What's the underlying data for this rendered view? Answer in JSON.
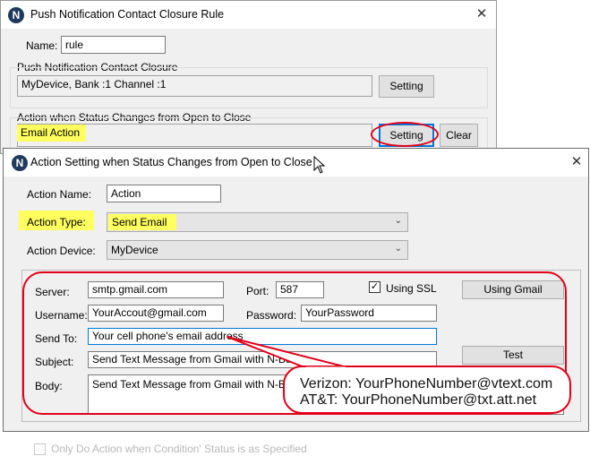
{
  "back_window": {
    "title": "Push Notification Contact Closure Rule",
    "name_label": "Name:",
    "name_value": "rule",
    "group1_title": "Push Notification Contact Closure",
    "device_text": "MyDevice, Bank :1 Channel :1",
    "setting1_label": "Setting",
    "group2_title": "Action when Status Changes from Open to Close",
    "action_text": "Email Action",
    "setting2_label": "Setting",
    "clear_label": "Clear",
    "footer_checkbox_label": "Only Do Action when Condition' Status is as Specified"
  },
  "front_window": {
    "title": "Action Setting when Status Changes from Open to Close",
    "action_name_label": "Action Name:",
    "action_name_value": "Action",
    "action_type_label": "Action Type:",
    "action_type_value": "Send Email",
    "action_device_label": "Action Device:",
    "action_device_value": "MyDevice",
    "server_label": "Server:",
    "server_value": "smtp.gmail.com",
    "port_label": "Port:",
    "port_value": "587",
    "ssl_label": "Using SSL",
    "ssl_checked": true,
    "using_gmail_label": "Using Gmail",
    "username_label": "Username:",
    "username_value": "YourAccout@gmail.com",
    "password_label": "Password:",
    "password_value": "YourPassword",
    "sendto_label": "Send To:",
    "sendto_value": "Your cell phone's email address",
    "test_label": "Test",
    "subject_label": "Subject:",
    "subject_value": "Send Text Message from Gmail with N-Button",
    "body_label": "Body:",
    "body_value": "Send Text Message from Gmail with N-Button"
  },
  "callout": {
    "line1": "Verizon: YourPhoneNumber@vtext.com",
    "line2": "AT&T: YourPhoneNumber@txt.att.net"
  },
  "icons": {
    "app_icon_letter": "N",
    "close": "✕",
    "dropdown": "⌄",
    "check": "✓"
  },
  "colors": {
    "annotation_red": "#e2001a",
    "highlight_yellow": "#ffff60",
    "focus_blue": "#0078d7"
  }
}
